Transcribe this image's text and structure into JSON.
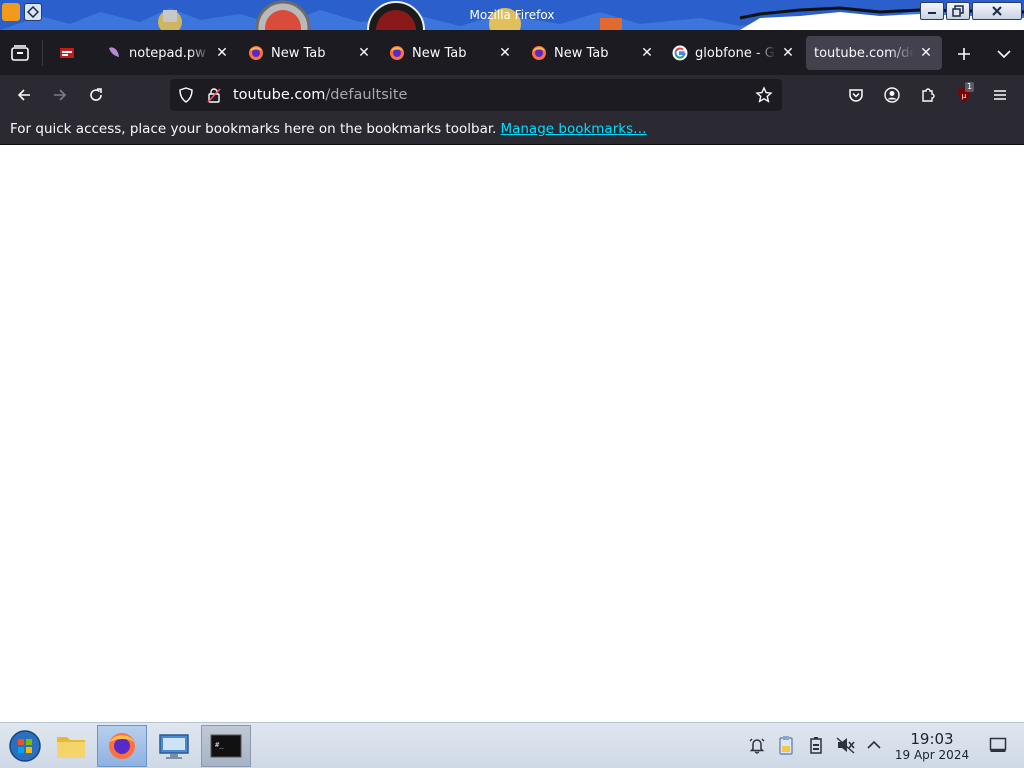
{
  "window": {
    "title": "Mozilla Firefox"
  },
  "tabs": [
    {
      "label": "",
      "favicon": "pinned-site-icon"
    },
    {
      "label": "notepad.pw",
      "favicon": "notepad-icon"
    },
    {
      "label": "New Tab",
      "favicon": "firefox-icon"
    },
    {
      "label": "New Tab",
      "favicon": "firefox-icon"
    },
    {
      "label": "New Tab",
      "favicon": "firefox-icon"
    },
    {
      "label": "globfone - G",
      "favicon": "google-icon"
    },
    {
      "label": "toutube.com/de",
      "favicon": "none",
      "active": true
    }
  ],
  "navbar": {
    "url_domain": "toutube.com",
    "url_path": "/defaultsite",
    "extension_badge": "1"
  },
  "bookmarks_bar": {
    "message": "For quick access, place your bookmarks here on the bookmarks toolbar.",
    "link": "Manage bookmarks…"
  },
  "taskbar": {
    "items": [
      "start-orb-icon",
      "file-manager-icon",
      "firefox-icon",
      "system-settings-icon",
      "terminal-icon"
    ],
    "active_item": "firefox-icon",
    "clock": {
      "time": "19:03",
      "date": "19 Apr 2024"
    }
  },
  "colors": {
    "tab_strip": "#1c1b22",
    "toolbar": "#2b2a33",
    "active_tab": "#42414d",
    "link": "#00ddff",
    "taskbar": "#d5dee9"
  }
}
